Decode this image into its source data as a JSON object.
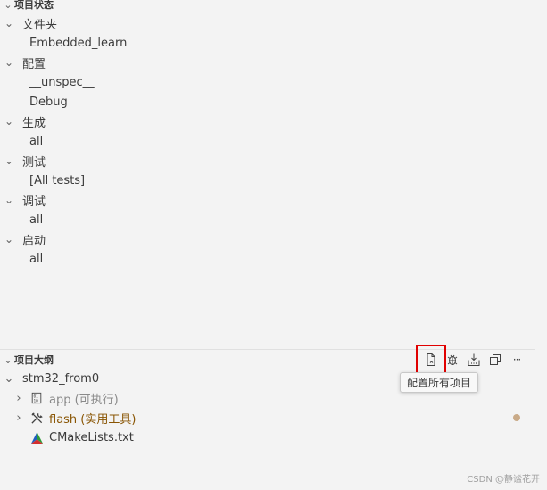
{
  "project_status": {
    "header": "项目状态",
    "groups": [
      {
        "label": "文件夹",
        "value": "Embedded_learn"
      },
      {
        "label": "配置",
        "values": [
          "__unspec__",
          "Debug"
        ]
      },
      {
        "label": "生成",
        "value": "all"
      },
      {
        "label": "测试",
        "value": "[All tests]"
      },
      {
        "label": "调试",
        "value": "all"
      },
      {
        "label": "启动",
        "value": "all"
      }
    ]
  },
  "outline": {
    "header": "项目大纲",
    "project": "stm32_from0",
    "items": [
      {
        "label": "app (可执行)",
        "icon": "binary-icon"
      },
      {
        "label": "flash (实用工具)",
        "icon": "tools-icon"
      },
      {
        "label": "CMakeLists.txt",
        "icon": "cmake-icon"
      }
    ],
    "toolbar": {
      "configure_icon": "configure-all-icon",
      "clean_icon": "clean-icon",
      "build_icon": "build-all-icon",
      "collapse_icon": "collapse-all-icon",
      "more_label": "···"
    },
    "tooltip": "配置所有项目"
  },
  "colors": {
    "background": "#f3f3f3",
    "text": "#3b3b3b",
    "modified": "#895503",
    "highlight_box": "#e00000"
  },
  "watermark": "CSDN @静谧花开"
}
